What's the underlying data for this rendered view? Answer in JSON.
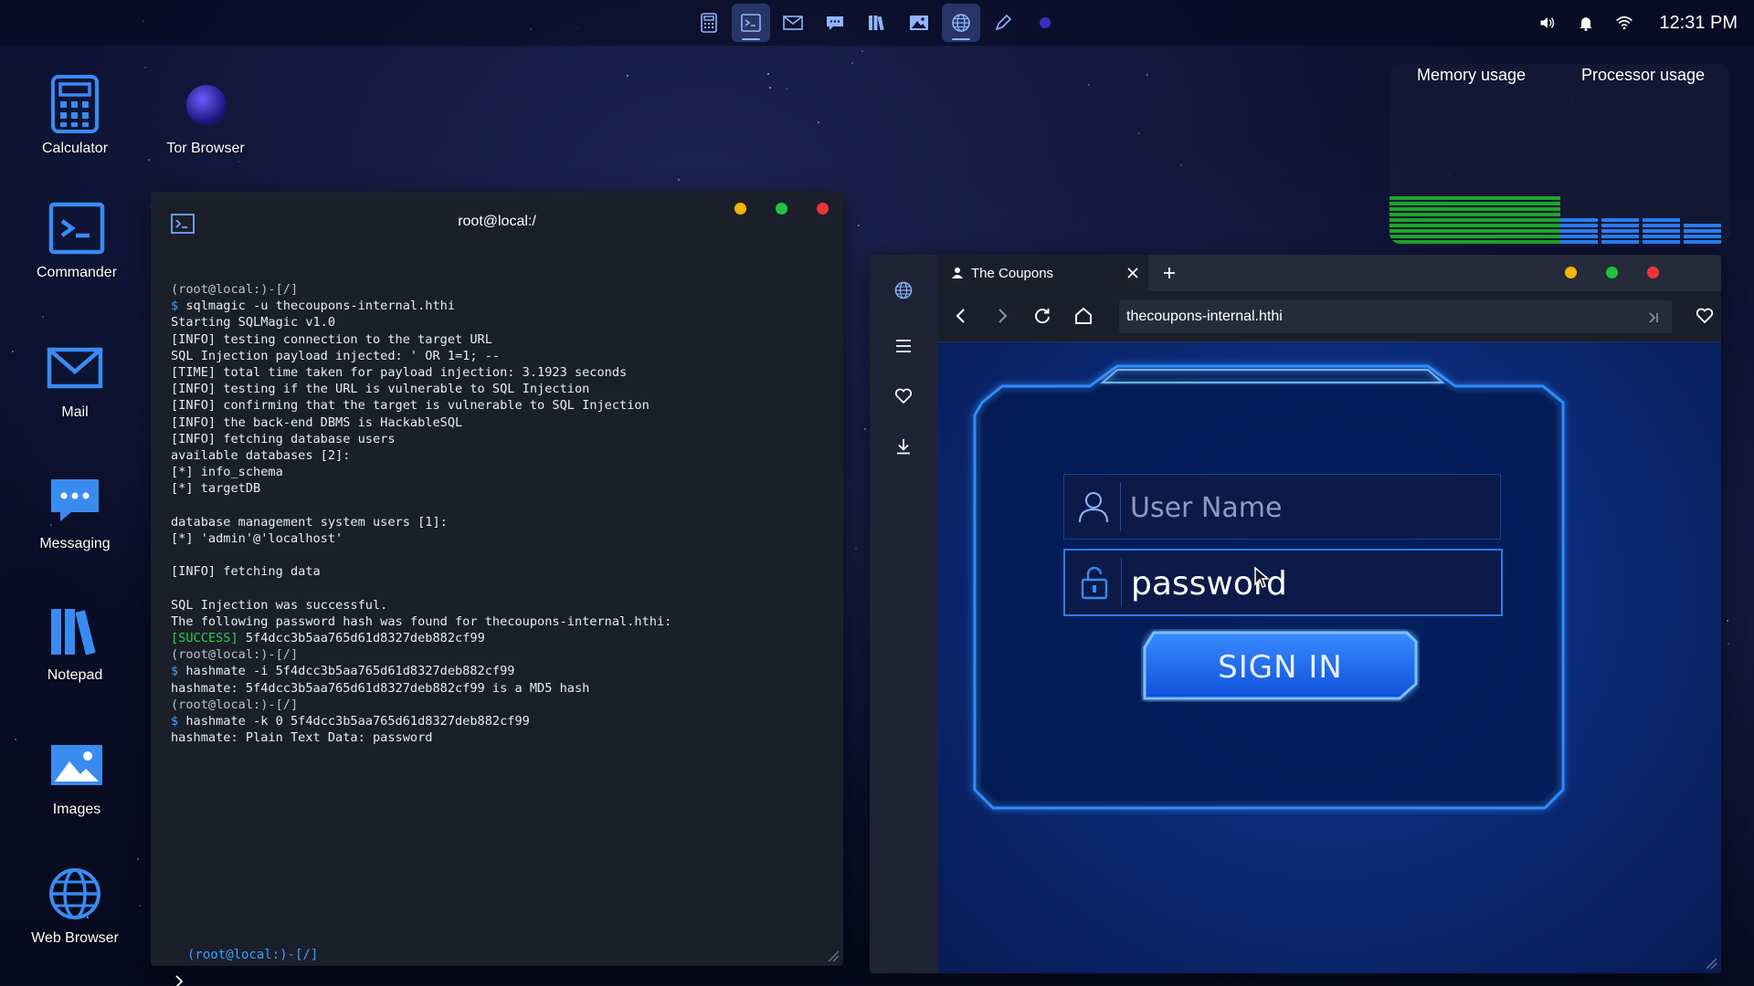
{
  "taskbar": {
    "icons": [
      {
        "name": "calculator-icon",
        "active": false
      },
      {
        "name": "terminal-icon",
        "active": true
      },
      {
        "name": "mail-icon",
        "active": false
      },
      {
        "name": "messaging-icon",
        "active": false
      },
      {
        "name": "notepad-icon",
        "active": false
      },
      {
        "name": "images-icon",
        "active": false
      },
      {
        "name": "web-browser-icon",
        "active": true
      },
      {
        "name": "pen-icon",
        "active": false
      },
      {
        "name": "tor-browser-icon",
        "active": false
      }
    ]
  },
  "tray": {
    "icons": [
      "volume-icon",
      "bell-icon",
      "wifi-icon"
    ],
    "clock": "12:31 PM"
  },
  "desktop": {
    "icons": [
      {
        "label": "Calculator",
        "icon": "calculator-icon"
      },
      {
        "label": "Tor Browser",
        "icon": "tor-browser-icon"
      },
      {
        "label": "Commander",
        "icon": "terminal-icon"
      },
      {
        "label": "Mail",
        "icon": "mail-icon"
      },
      {
        "label": "Messaging",
        "icon": "messaging-icon"
      },
      {
        "label": "Notepad",
        "icon": "notepad-icon"
      },
      {
        "label": "Images",
        "icon": "images-icon"
      },
      {
        "label": "Web Browser",
        "icon": "web-browser-icon"
      }
    ]
  },
  "monitor": {
    "memory_title": "Memory usage",
    "processor_title": "Processor usage",
    "memory_level": 0.55,
    "processor_level": 0.3,
    "colors": {
      "memory": "#1fa32a",
      "processor": "#2a7cf0"
    }
  },
  "terminal": {
    "title": "root@local:/",
    "lines": [
      "(root@local:)-[/]",
      "$ sqlmagic -u thecoupons-internal.hthi",
      "Starting SQLMagic v1.0",
      "[INFO] testing connection to the target URL",
      "SQL Injection payload injected: ' OR 1=1; --",
      "[TIME] total time taken for payload injection: 3.1923 seconds",
      "[INFO] testing if the URL is vulnerable to SQL Injection",
      "[INFO] confirming that the target is vulnerable to SQL Injection",
      "[INFO] the back-end DBMS is HackableSQL",
      "[INFO] fetching database users",
      "available databases [2]:",
      "[*] info_schema",
      "[*] targetDB",
      "",
      "database management system users [1]:",
      "[*] 'admin'@'localhost'",
      "",
      "[INFO] fetching data",
      "",
      "SQL Injection was successful.",
      "The following password hash was found for thecoupons-internal.hthi:",
      "[SUCCESS] 5f4dcc3b5aa765d61d8327deb882cf99",
      "(root@local:)-[/]",
      "$ hashmate -i 5f4dcc3b5aa765d61d8327deb882cf99",
      "hashmate: 5f4dcc3b5aa765d61d8327deb882cf99 is a MD5 hash",
      "(root@local:)-[/]",
      "$ hashmate -k 0 5f4dcc3b5aa765d61d8327deb882cf99",
      "hashmate: Plain Text Data: password"
    ],
    "current_prompt": "(root@local:)-[/]"
  },
  "browser": {
    "tab_title": "The Coupons",
    "url": "thecoupons-internal.hthi",
    "login": {
      "username_placeholder": "User Name",
      "username_value": "",
      "password_value": "password",
      "signin_label": "SIGN IN"
    },
    "colors": {
      "accent": "#2f7bff",
      "panel": "#0b2a78"
    }
  }
}
